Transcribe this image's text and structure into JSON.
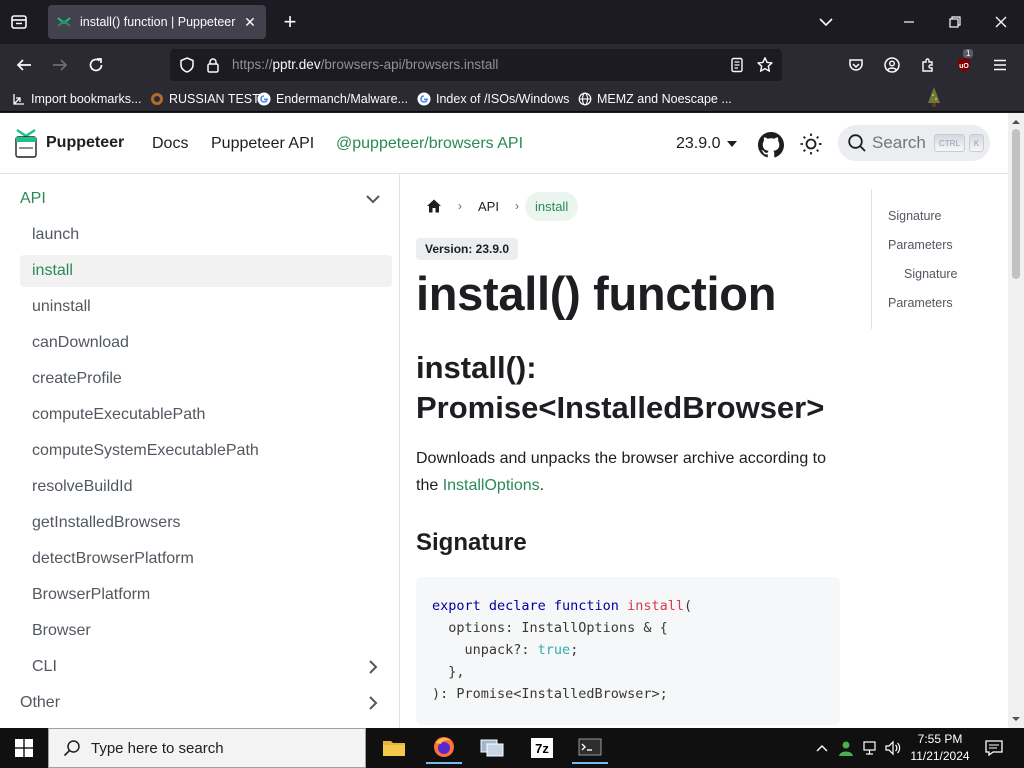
{
  "browser": {
    "tab_title": "install() function | Puppeteer",
    "url_scheme": "https://",
    "url_host": "pptr.dev",
    "url_path": "/browsers-api/browsers.install",
    "extension_badge": "1",
    "bookmarks": [
      {
        "label": "Import bookmarks...",
        "icon": "import-icon"
      },
      {
        "label": "RUSSIAN TEST",
        "icon": "russian-test-favicon"
      },
      {
        "label": "Endermanch/Malware...",
        "icon": "google-icon"
      },
      {
        "label": "Index of /ISOs/Windows",
        "icon": "google-icon"
      },
      {
        "label": "MEMZ and Noescape ...",
        "icon": "globe-icon"
      }
    ]
  },
  "site": {
    "brand": "Puppeteer",
    "nav": [
      "Docs",
      "Puppeteer API",
      "@puppeteer/browsers API"
    ],
    "version": "23.9.0",
    "search_placeholder": "Search",
    "kbd_ctrl": "CTRL",
    "kbd_k": "K"
  },
  "sidebar": {
    "category": "API",
    "items": [
      "launch",
      "install",
      "uninstall",
      "canDownload",
      "createProfile",
      "computeExecutablePath",
      "computeSystemExecutablePath",
      "resolveBuildId",
      "getInstalledBrowsers",
      "detectBrowserPlatform",
      "BrowserPlatform",
      "Browser",
      "CLI"
    ],
    "active": "install",
    "other": "Other"
  },
  "content": {
    "crumb_api": "API",
    "crumb_current": "install",
    "version_badge": "Version: 23.9.0",
    "title": "install() function",
    "signature_heading_line1": "install():",
    "signature_heading_line2": "Promise<InstalledBrowser>",
    "desc_prefix": "Downloads and unpacks the browser archive according to the ",
    "desc_link": "InstallOptions",
    "desc_suffix": ".",
    "section_signature": "Signature",
    "code": {
      "l1_kw": "export declare function ",
      "l1_fn": "install",
      "l1_rest": "(",
      "l2": "  options: InstallOptions & {",
      "l3_a": "    unpack?: ",
      "l3_bool": "true",
      "l3_b": ";",
      "l4": "  },",
      "l5": "): Promise<InstalledBrowser>;"
    }
  },
  "toc": [
    "Signature",
    "Parameters",
    "Signature",
    "Parameters"
  ],
  "taskbar": {
    "search_placeholder": "Type here to search",
    "time": "7:55 PM",
    "date": "11/21/2024"
  }
}
